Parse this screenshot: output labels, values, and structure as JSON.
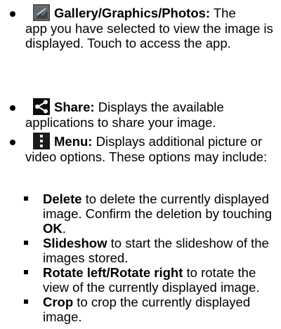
{
  "items": [
    {
      "icon": "gallery-icon",
      "title": "Gallery/Graphics/Photos:",
      "text_first": " The",
      "text_rest": "app you have selected to view the image is displayed. Touch to access the app."
    },
    {
      "icon": "share-icon",
      "title": "Share:",
      "text_first": " Displays the available",
      "text_rest": "applications to share your image."
    },
    {
      "icon": "menu-icon",
      "title": "Menu:",
      "text_first": " Displays additional picture or",
      "text_rest": "video options. These options may include:"
    }
  ],
  "subitems": [
    {
      "bold": "Delete",
      "text": " to delete the currently displayed image. Confirm the deletion by touching ",
      "bold2": "OK",
      "text2": "."
    },
    {
      "bold": "Slideshow",
      "text": " to start the slideshow of the images stored."
    },
    {
      "bold": "Rotate left/Rotate right",
      "text": " to rotate the view of the currently displayed image."
    },
    {
      "bold": "Crop",
      "text": " to crop the currently displayed image."
    }
  ],
  "colors": {
    "gallery_icon_bg": "#3a3a3a",
    "share_icon_bg": "#111111",
    "menu_icon_bg": "#1a1a1a"
  }
}
